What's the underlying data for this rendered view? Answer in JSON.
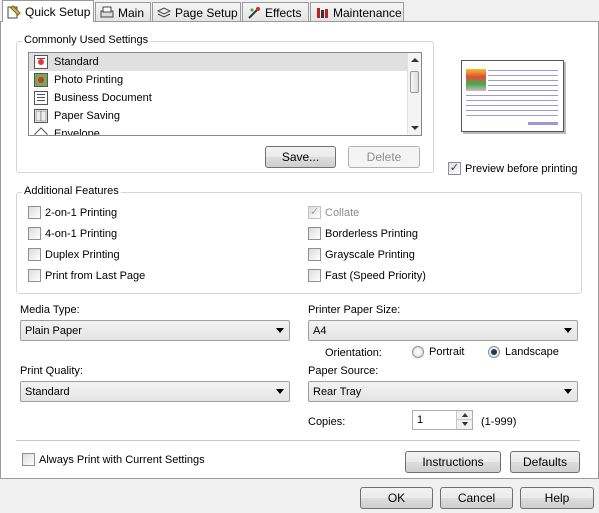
{
  "tabs": [
    {
      "label": "Quick Setup",
      "icon": "quick-setup-icon",
      "active": true
    },
    {
      "label": "Main",
      "icon": "main-icon"
    },
    {
      "label": "Page Setup",
      "icon": "page-setup-icon"
    },
    {
      "label": "Effects",
      "icon": "effects-icon"
    },
    {
      "label": "Maintenance",
      "icon": "maintenance-icon"
    }
  ],
  "common": {
    "title": "Commonly Used Settings",
    "items": [
      {
        "label": "Standard",
        "icon": "standard-icon",
        "selected": true
      },
      {
        "label": "Photo Printing",
        "icon": "photo-icon"
      },
      {
        "label": "Business Document",
        "icon": "document-icon"
      },
      {
        "label": "Paper Saving",
        "icon": "paper-saving-icon"
      },
      {
        "label": "Envelope",
        "icon": "envelope-icon"
      }
    ],
    "save_label": "Save...",
    "delete_label": "Delete"
  },
  "preview": {
    "checkbox_label": "Preview before printing",
    "checked": true
  },
  "features": {
    "title": "Additional Features",
    "left": [
      {
        "label": "2-on-1 Printing",
        "checked": false
      },
      {
        "label": "4-on-1 Printing",
        "checked": false
      },
      {
        "label": "Duplex Printing",
        "checked": false
      },
      {
        "label": "Print from Last Page",
        "checked": false
      }
    ],
    "right": [
      {
        "label": "Collate",
        "checked": true,
        "disabled": true
      },
      {
        "label": "Borderless Printing",
        "checked": false
      },
      {
        "label": "Grayscale Printing",
        "checked": false
      },
      {
        "label": "Fast (Speed Priority)",
        "checked": false
      }
    ]
  },
  "media": {
    "label": "Media Type:",
    "value": "Plain Paper"
  },
  "paper_size": {
    "label": "Printer Paper Size:",
    "value": "A4"
  },
  "orientation": {
    "label": "Orientation:",
    "portrait": "Portrait",
    "landscape": "Landscape",
    "selected": "landscape"
  },
  "quality": {
    "label": "Print Quality:",
    "value": "Standard"
  },
  "source": {
    "label": "Paper Source:",
    "value": "Rear Tray"
  },
  "copies": {
    "label": "Copies:",
    "value": "1",
    "range": "(1-999)"
  },
  "always_print_label": "Always Print with Current Settings",
  "instructions_label": "Instructions",
  "defaults_label": "Defaults",
  "footer": {
    "ok": "OK",
    "cancel": "Cancel",
    "help": "Help"
  },
  "colors": {
    "selection": "#e0e0e0",
    "accent": "#1c3b63",
    "preview_line": "#9a9ad8"
  }
}
